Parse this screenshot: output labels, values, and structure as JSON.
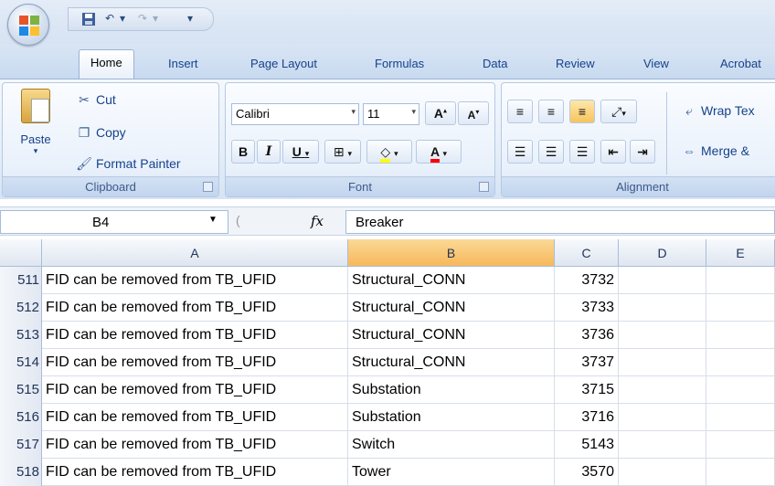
{
  "quick_access": {
    "save_icon": "save-icon",
    "undo_icon": "undo-icon",
    "redo_icon": "redo-icon",
    "customize_icon": "customize-icon"
  },
  "tabs": [
    {
      "label": "Home",
      "active": true
    },
    {
      "label": "Insert"
    },
    {
      "label": "Page Layout"
    },
    {
      "label": "Formulas"
    },
    {
      "label": "Data"
    },
    {
      "label": "Review"
    },
    {
      "label": "View"
    },
    {
      "label": "Acrobat"
    }
  ],
  "ribbon": {
    "clipboard": {
      "paste_label": "Paste",
      "cut_label": "Cut",
      "copy_label": "Copy",
      "format_painter_label": "Format Painter",
      "group_label": "Clipboard"
    },
    "font": {
      "font_name": "Calibri",
      "font_size": "11",
      "grow_label": "A",
      "shrink_label": "A",
      "bold_label": "B",
      "italic_label": "I",
      "underline_label": "U",
      "font_color_label": "A",
      "group_label": "Font"
    },
    "alignment": {
      "wrap_text_label": "Wrap Tex",
      "merge_label": "Merge &",
      "group_label": "Alignment"
    }
  },
  "formula_bar": {
    "name_box": "B4",
    "fx_label": "fx",
    "formula": "Breaker"
  },
  "columns": [
    {
      "label": "A",
      "selected": false
    },
    {
      "label": "B",
      "selected": true
    },
    {
      "label": "C",
      "selected": false
    },
    {
      "label": "D",
      "selected": false
    },
    {
      "label": "E",
      "selected": false
    }
  ],
  "rows": [
    {
      "num": "511",
      "a": "FID can be removed from TB_UFID",
      "b": "Structural_CONN",
      "c": "3732"
    },
    {
      "num": "512",
      "a": "FID can be removed from TB_UFID",
      "b": "Structural_CONN",
      "c": "3733"
    },
    {
      "num": "513",
      "a": "FID can be removed from TB_UFID",
      "b": "Structural_CONN",
      "c": "3736"
    },
    {
      "num": "514",
      "a": "FID can be removed from TB_UFID",
      "b": "Structural_CONN",
      "c": "3737"
    },
    {
      "num": "515",
      "a": "FID can be removed from TB_UFID",
      "b": "Substation",
      "c": "3715"
    },
    {
      "num": "516",
      "a": "FID can be removed from TB_UFID",
      "b": "Substation",
      "c": "3716"
    },
    {
      "num": "517",
      "a": "FID can be removed from TB_UFID",
      "b": "Switch",
      "c": "5143"
    },
    {
      "num": "518",
      "a": "FID can be removed from TB_UFID",
      "b": "Tower",
      "c": "3570"
    }
  ]
}
